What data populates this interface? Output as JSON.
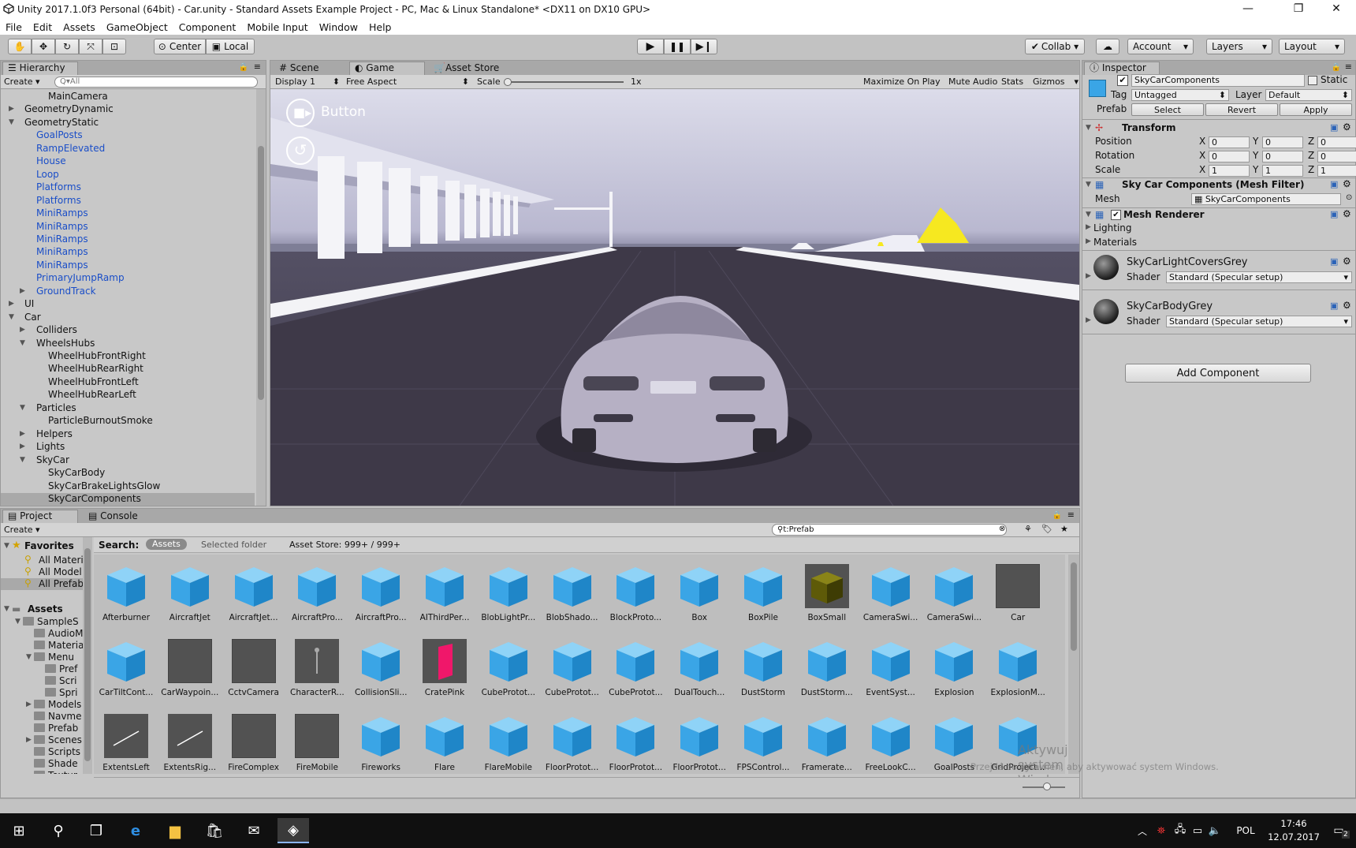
{
  "window": {
    "title": "Unity 2017.1.0f3 Personal (64bit) - Car.unity - Standard Assets Example Project - PC, Mac & Linux Standalone* <DX11 on DX10 GPU>",
    "minimize": "—",
    "maximize": "❐",
    "close": "✕"
  },
  "menu": [
    "File",
    "Edit",
    "Assets",
    "GameObject",
    "Component",
    "Mobile Input",
    "Window",
    "Help"
  ],
  "toolbar": {
    "pivot": "Center",
    "space": "Local",
    "collab": "Collab ▾",
    "account": "Account",
    "layers": "Layers",
    "layout": "Layout"
  },
  "hierarchy": {
    "tab": "Hierarchy",
    "create": "Create",
    "search_placeholder": "Q▾All",
    "items": [
      {
        "label": "MainCamera",
        "depth": 3,
        "arrow": "",
        "blue": false
      },
      {
        "label": "GeometryDynamic",
        "depth": 1,
        "arrow": "▶",
        "blue": false
      },
      {
        "label": "GeometryStatic",
        "depth": 1,
        "arrow": "▼",
        "blue": false
      },
      {
        "label": "GoalPosts",
        "depth": 2,
        "arrow": "",
        "blue": true
      },
      {
        "label": "RampElevated",
        "depth": 2,
        "arrow": "",
        "blue": true
      },
      {
        "label": "House",
        "depth": 2,
        "arrow": "",
        "blue": true
      },
      {
        "label": "Loop",
        "depth": 2,
        "arrow": "",
        "blue": true
      },
      {
        "label": "Platforms",
        "depth": 2,
        "arrow": "",
        "blue": true
      },
      {
        "label": "Platforms",
        "depth": 2,
        "arrow": "",
        "blue": true
      },
      {
        "label": "MiniRamps",
        "depth": 2,
        "arrow": "",
        "blue": true
      },
      {
        "label": "MiniRamps",
        "depth": 2,
        "arrow": "",
        "blue": true
      },
      {
        "label": "MiniRamps",
        "depth": 2,
        "arrow": "",
        "blue": true
      },
      {
        "label": "MiniRamps",
        "depth": 2,
        "arrow": "",
        "blue": true
      },
      {
        "label": "MiniRamps",
        "depth": 2,
        "arrow": "",
        "blue": true
      },
      {
        "label": "PrimaryJumpRamp",
        "depth": 2,
        "arrow": "",
        "blue": true
      },
      {
        "label": "GroundTrack",
        "depth": 2,
        "arrow": "▶",
        "blue": true
      },
      {
        "label": "UI",
        "depth": 1,
        "arrow": "▶",
        "blue": false
      },
      {
        "label": "Car",
        "depth": 1,
        "arrow": "▼",
        "blue": false
      },
      {
        "label": "Colliders",
        "depth": 2,
        "arrow": "▶",
        "blue": false
      },
      {
        "label": "WheelsHubs",
        "depth": 2,
        "arrow": "▼",
        "blue": false
      },
      {
        "label": "WheelHubFrontRight",
        "depth": 3,
        "arrow": "",
        "blue": false
      },
      {
        "label": "WheelHubRearRight",
        "depth": 3,
        "arrow": "",
        "blue": false
      },
      {
        "label": "WheelHubFrontLeft",
        "depth": 3,
        "arrow": "",
        "blue": false
      },
      {
        "label": "WheelHubRearLeft",
        "depth": 3,
        "arrow": "",
        "blue": false
      },
      {
        "label": "Particles",
        "depth": 2,
        "arrow": "▼",
        "blue": false
      },
      {
        "label": "ParticleBurnoutSmoke",
        "depth": 3,
        "arrow": "",
        "blue": false
      },
      {
        "label": "Helpers",
        "depth": 2,
        "arrow": "▶",
        "blue": false
      },
      {
        "label": "Lights",
        "depth": 2,
        "arrow": "▶",
        "blue": false
      },
      {
        "label": "SkyCar",
        "depth": 2,
        "arrow": "▼",
        "blue": false
      },
      {
        "label": "SkyCarBody",
        "depth": 3,
        "arrow": "",
        "blue": false
      },
      {
        "label": "SkyCarBrakeLightsGlow",
        "depth": 3,
        "arrow": "",
        "blue": false
      },
      {
        "label": "SkyCarComponents",
        "depth": 3,
        "arrow": "",
        "blue": false,
        "selected": true
      }
    ]
  },
  "game": {
    "tabs": [
      "Scene",
      "Game",
      "Asset Store"
    ],
    "display": "Display 1",
    "aspect": "Free Aspect",
    "scale_label": "Scale",
    "scale_value": "1x",
    "maximize": "Maximize On Play",
    "mute": "Mute Audio",
    "stats": "Stats",
    "gizmos": "Gizmos",
    "overlay_button": "Button"
  },
  "inspector": {
    "tab": "Inspector",
    "object_name": "SkyCarComponents",
    "static": "Static",
    "tag_label": "Tag",
    "tag": "Untagged",
    "layer_label": "Layer",
    "layer": "Default",
    "prefab_label": "Prefab",
    "select": "Select",
    "revert": "Revert",
    "apply": "Apply",
    "transform": "Transform",
    "position_label": "Position",
    "rotation_label": "Rotation",
    "scale_label": "Scale",
    "axis_x": "X",
    "axis_y": "Y",
    "axis_z": "Z",
    "position": [
      "0",
      "0",
      "0"
    ],
    "rotation": [
      "0",
      "0",
      "0"
    ],
    "scale": [
      "1",
      "1",
      "1"
    ],
    "mesh_filter": "Sky Car Components (Mesh Filter)",
    "mesh_label": "Mesh",
    "mesh_value": "SkyCarComponents",
    "mesh_renderer": "Mesh Renderer",
    "lighting": "Lighting",
    "materials": "Materials",
    "mat1_name": "SkyCarLightCoversGrey",
    "mat2_name": "SkyCarBodyGrey",
    "shader_label": "Shader",
    "shader_value": "Standard (Specular setup)",
    "add_component": "Add Component"
  },
  "project": {
    "tabs": [
      "Project",
      "Console"
    ],
    "create": "Create",
    "search_value": "t:Prefab",
    "search_label": "Search:",
    "scope_assets": "Assets",
    "scope_selected": "Selected folder",
    "asset_store": "Asset Store: 999+ / 999+",
    "favorites_label": "Favorites",
    "favorites": [
      "All Materi",
      "All Model",
      "All Prefab"
    ],
    "assets_label": "Assets",
    "folders": [
      {
        "label": "SampleS",
        "depth": 1,
        "arrow": "▼"
      },
      {
        "label": "AudioM",
        "depth": 2,
        "arrow": ""
      },
      {
        "label": "Materia",
        "depth": 2,
        "arrow": ""
      },
      {
        "label": "Menu",
        "depth": 2,
        "arrow": "▼"
      },
      {
        "label": "Pref",
        "depth": 3,
        "arrow": ""
      },
      {
        "label": "Scri",
        "depth": 3,
        "arrow": ""
      },
      {
        "label": "Spri",
        "depth": 3,
        "arrow": ""
      },
      {
        "label": "Models",
        "depth": 2,
        "arrow": "▶"
      },
      {
        "label": "Navme",
        "depth": 2,
        "arrow": ""
      },
      {
        "label": "Prefab",
        "depth": 2,
        "arrow": ""
      },
      {
        "label": "Scenes",
        "depth": 2,
        "arrow": "▶"
      },
      {
        "label": "Scripts",
        "depth": 2,
        "arrow": ""
      },
      {
        "label": "Shade",
        "depth": 2,
        "arrow": ""
      },
      {
        "label": "Textur",
        "depth": 2,
        "arrow": ""
      }
    ],
    "assets": [
      {
        "label": "Afterburner",
        "kind": "cube"
      },
      {
        "label": "AircraftJet",
        "kind": "cube"
      },
      {
        "label": "AircraftJet...",
        "kind": "cube"
      },
      {
        "label": "AircraftPro...",
        "kind": "cube"
      },
      {
        "label": "AircraftPro...",
        "kind": "cube"
      },
      {
        "label": "AIThirdPer...",
        "kind": "cube"
      },
      {
        "label": "BlobLightPr...",
        "kind": "cube"
      },
      {
        "label": "BlobShado...",
        "kind": "cube"
      },
      {
        "label": "BlockProto...",
        "kind": "cube"
      },
      {
        "label": "Box",
        "kind": "cube"
      },
      {
        "label": "BoxPile",
        "kind": "cube"
      },
      {
        "label": "BoxSmall",
        "kind": "yellowbox"
      },
      {
        "label": "CameraSwi...",
        "kind": "cube"
      },
      {
        "label": "CameraSwi...",
        "kind": "cube"
      },
      {
        "label": "Car",
        "kind": "dark"
      },
      {
        "label": "CarTiltCont...",
        "kind": "cube"
      },
      {
        "label": "CarWaypoin...",
        "kind": "dark"
      },
      {
        "label": "CctvCamera",
        "kind": "dark"
      },
      {
        "label": "CharacterR...",
        "kind": "char"
      },
      {
        "label": "CollisionSli...",
        "kind": "cube"
      },
      {
        "label": "CratePink",
        "kind": "pink"
      },
      {
        "label": "CubeProtot...",
        "kind": "cube"
      },
      {
        "label": "CubeProtot...",
        "kind": "cube"
      },
      {
        "label": "CubeProtot...",
        "kind": "cube"
      },
      {
        "label": "DualTouch...",
        "kind": "cube"
      },
      {
        "label": "DustStorm",
        "kind": "cube"
      },
      {
        "label": "DustStorm...",
        "kind": "cube"
      },
      {
        "label": "EventSyst...",
        "kind": "cube"
      },
      {
        "label": "Explosion",
        "kind": "cube"
      },
      {
        "label": "ExplosionM...",
        "kind": "cube"
      },
      {
        "label": "ExtentsLeft",
        "kind": "line"
      },
      {
        "label": "ExtentsRig...",
        "kind": "line"
      },
      {
        "label": "FireComplex",
        "kind": "dark"
      },
      {
        "label": "FireMobile",
        "kind": "dark"
      },
      {
        "label": "Fireworks",
        "kind": "cube"
      },
      {
        "label": "Flare",
        "kind": "cube"
      },
      {
        "label": "FlareMobile",
        "kind": "cube"
      },
      {
        "label": "FloorProtot...",
        "kind": "cube"
      },
      {
        "label": "FloorProtot...",
        "kind": "cube"
      },
      {
        "label": "FloorProtot...",
        "kind": "cube"
      },
      {
        "label": "FPSControl...",
        "kind": "cube"
      },
      {
        "label": "Framerate...",
        "kind": "cube"
      },
      {
        "label": "FreeLookC...",
        "kind": "cube"
      },
      {
        "label": "GoalPosts",
        "kind": "cube"
      },
      {
        "label": "GridProject...",
        "kind": "cube"
      }
    ],
    "watermark_line1": "Aktywuj system Windows",
    "watermark_line2": "Przejdź do ustawień, aby aktywować system Windows."
  },
  "taskbar": {
    "language": "POL",
    "time": "17:46",
    "date": "12.07.2017",
    "notifications": "2"
  },
  "colors": {
    "cube": "#3aa5e6",
    "panel": "#c2c2c2",
    "selection": "#a9a9a9",
    "link_blue": "#1a4ec8",
    "taskbar": "#101010"
  }
}
